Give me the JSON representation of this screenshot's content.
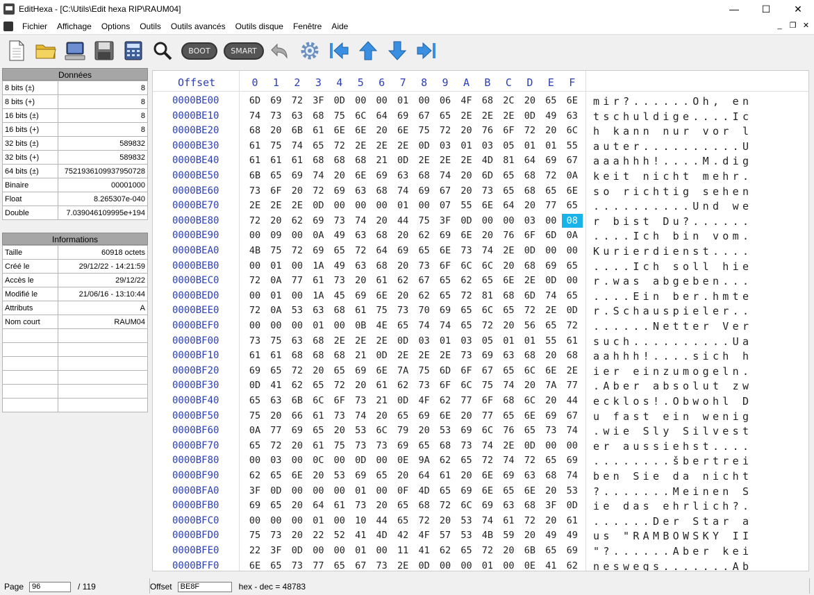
{
  "window": {
    "title": "EditHexa - [C:\\Utils\\Edit hexa RIP\\RAUM04]"
  },
  "menu": [
    "Fichier",
    "Affichage",
    "Options",
    "Outils",
    "Outils avancés",
    "Outils disque",
    "Fenêtre",
    "Aide"
  ],
  "toolbar": {
    "boot_label": "BOOT",
    "smart_label": "SMART"
  },
  "donnees": {
    "title": "Données",
    "rows": [
      {
        "k": "8 bits (±)",
        "v": "8"
      },
      {
        "k": "8 bits (+)",
        "v": "8"
      },
      {
        "k": "16 bits (±)",
        "v": "8"
      },
      {
        "k": "16 bits (+)",
        "v": "8"
      },
      {
        "k": "32 bits (±)",
        "v": "589832"
      },
      {
        "k": "32 bits (+)",
        "v": "589832"
      },
      {
        "k": "64 bits (±)",
        "v": "7521936109937950728"
      },
      {
        "k": "Binaire",
        "v": "00001000"
      },
      {
        "k": "Float",
        "v": "8.265307e-040"
      },
      {
        "k": "Double",
        "v": "7.039046109995e+194"
      }
    ]
  },
  "informations": {
    "title": "Informations",
    "rows": [
      {
        "k": "Taille",
        "v": "60918 octets"
      },
      {
        "k": "Créé le",
        "v": "29/12/22 - 14:21:59"
      },
      {
        "k": "Accès le",
        "v": "29/12/22"
      },
      {
        "k": "Modifié le",
        "v": "21/06/16 - 13:10:44"
      },
      {
        "k": "Attributs",
        "v": "A"
      },
      {
        "k": "Nom court",
        "v": "RAUM04"
      },
      {
        "k": "",
        "v": ""
      },
      {
        "k": "",
        "v": ""
      },
      {
        "k": "",
        "v": ""
      },
      {
        "k": "",
        "v": ""
      },
      {
        "k": "",
        "v": ""
      },
      {
        "k": "",
        "v": ""
      }
    ]
  },
  "hex": {
    "offset_label": "Offset",
    "columns": [
      "0",
      "1",
      "2",
      "3",
      "4",
      "5",
      "6",
      "7",
      "8",
      "9",
      "A",
      "B",
      "C",
      "D",
      "E",
      "F"
    ],
    "selected": {
      "row": 8,
      "col": 15
    },
    "rows": [
      {
        "off": "0000BE00",
        "b": "6D 69 72 3F 0D 00 00 01 00 06 4F 68 2C 20 65 6E",
        "a": "mir?......Oh, en"
      },
      {
        "off": "0000BE10",
        "b": "74 73 63 68 75 6C 64 69 67 65 2E 2E 2E 0D 49 63",
        "a": "tschuldige....Ic"
      },
      {
        "off": "0000BE20",
        "b": "68 20 6B 61 6E 6E 20 6E 75 72 20 76 6F 72 20 6C",
        "a": "h kann nur vor l"
      },
      {
        "off": "0000BE30",
        "b": "61 75 74 65 72 2E 2E 2E 0D 03 01 03 05 01 01 55",
        "a": "auter..........U"
      },
      {
        "off": "0000BE40",
        "b": "61 61 61 68 68 68 21 0D 2E 2E 2E 4D 81 64 69 67",
        "a": "aaahhh!....M.dig"
      },
      {
        "off": "0000BE50",
        "b": "6B 65 69 74 20 6E 69 63 68 74 20 6D 65 68 72 0A",
        "a": "keit nicht mehr."
      },
      {
        "off": "0000BE60",
        "b": "73 6F 20 72 69 63 68 74 69 67 20 73 65 68 65 6E",
        "a": "so richtig sehen"
      },
      {
        "off": "0000BE70",
        "b": "2E 2E 2E 0D 00 00 00 01 00 07 55 6E 64 20 77 65",
        "a": "..........Und we"
      },
      {
        "off": "0000BE80",
        "b": "72 20 62 69 73 74 20 44 75 3F 0D 00 00 03 00 08",
        "a": "r bist Du?......"
      },
      {
        "off": "0000BE90",
        "b": "00 09 00 0A 49 63 68 20 62 69 6E 20 76 6F 6D 0A",
        "a": "....Ich bin vom."
      },
      {
        "off": "0000BEA0",
        "b": "4B 75 72 69 65 72 64 69 65 6E 73 74 2E 0D 00 00",
        "a": "Kurierdienst...."
      },
      {
        "off": "0000BEB0",
        "b": "00 01 00 1A 49 63 68 20 73 6F 6C 6C 20 68 69 65",
        "a": "....Ich soll hie"
      },
      {
        "off": "0000BEC0",
        "b": "72 0A 77 61 73 20 61 62 67 65 62 65 6E 2E 0D 00",
        "a": "r.was abgeben..."
      },
      {
        "off": "0000BED0",
        "b": "00 01 00 1A 45 69 6E 20 62 65 72 81 68 6D 74 65",
        "a": "....Ein ber.hmte"
      },
      {
        "off": "0000BEE0",
        "b": "72 0A 53 63 68 61 75 73 70 69 65 6C 65 72 2E 0D",
        "a": "r.Schauspieler.."
      },
      {
        "off": "0000BEF0",
        "b": "00 00 00 01 00 0B 4E 65 74 74 65 72 20 56 65 72",
        "a": "......Netter Ver"
      },
      {
        "off": "0000BF00",
        "b": "73 75 63 68 2E 2E 2E 0D 03 01 03 05 01 01 55 61",
        "a": "such..........Ua"
      },
      {
        "off": "0000BF10",
        "b": "61 61 68 68 68 21 0D 2E 2E 2E 73 69 63 68 20 68",
        "a": "aahhh!....sich h"
      },
      {
        "off": "0000BF20",
        "b": "69 65 72 20 65 69 6E 7A 75 6D 6F 67 65 6C 6E 2E",
        "a": "ier einzumogeln."
      },
      {
        "off": "0000BF30",
        "b": "0D 41 62 65 72 20 61 62 73 6F 6C 75 74 20 7A 77",
        "a": ".Aber absolut zw"
      },
      {
        "off": "0000BF40",
        "b": "65 63 6B 6C 6F 73 21 0D 4F 62 77 6F 68 6C 20 44",
        "a": "ecklos!.Obwohl D"
      },
      {
        "off": "0000BF50",
        "b": "75 20 66 61 73 74 20 65 69 6E 20 77 65 6E 69 67",
        "a": "u fast ein wenig"
      },
      {
        "off": "0000BF60",
        "b": "0A 77 69 65 20 53 6C 79 20 53 69 6C 76 65 73 74",
        "a": ".wie Sly Silvest"
      },
      {
        "off": "0000BF70",
        "b": "65 72 20 61 75 73 73 69 65 68 73 74 2E 0D 00 00",
        "a": "er aussiehst...."
      },
      {
        "off": "0000BF80",
        "b": "00 03 00 0C 00 0D 00 0E 9A 62 65 72 74 72 65 69",
        "a": "........šbertrei"
      },
      {
        "off": "0000BF90",
        "b": "62 65 6E 20 53 69 65 20 64 61 20 6E 69 63 68 74",
        "a": "ben Sie da nicht"
      },
      {
        "off": "0000BFA0",
        "b": "3F 0D 00 00 00 01 00 0F 4D 65 69 6E 65 6E 20 53",
        "a": "?.......Meinen S"
      },
      {
        "off": "0000BFB0",
        "b": "69 65 20 64 61 73 20 65 68 72 6C 69 63 68 3F 0D",
        "a": "ie das ehrlich?."
      },
      {
        "off": "0000BFC0",
        "b": "00 00 00 01 00 10 44 65 72 20 53 74 61 72 20 61",
        "a": "......Der Star a"
      },
      {
        "off": "0000BFD0",
        "b": "75 73 20 22 52 41 4D 42 4F 57 53 4B 59 20 49 49",
        "a": "us \"RAMBOWSKY II"
      },
      {
        "off": "0000BFE0",
        "b": "22 3F 0D 00 00 01 00 11 41 62 65 72 20 6B 65 69",
        "a": "\"?......Aber kei"
      },
      {
        "off": "0000BFF0",
        "b": "6E 65 73 77 65 67 73 2E 0D 00 00 01 00 0E 41 62",
        "a": "neswegs.......Ab"
      }
    ]
  },
  "status": {
    "page_label": "Page",
    "page_value": "96",
    "page_total": "/ 119",
    "offset_label": "Offset",
    "offset_value": "BE8F",
    "hexdec": "hex - dec = 48783"
  }
}
